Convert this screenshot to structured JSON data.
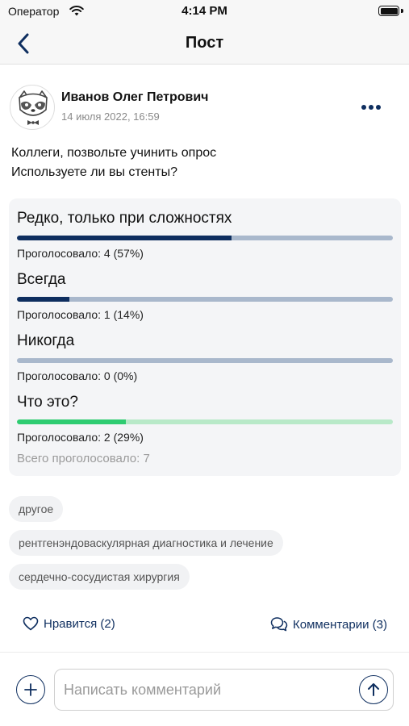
{
  "status_bar": {
    "carrier": "Оператор",
    "time": "4:14 PM"
  },
  "nav": {
    "title": "Пост"
  },
  "post": {
    "author": "Иванов Олег Петрович",
    "date": "14 июля 2022, 16:59",
    "text_line1": "Коллеги, позвольте учинить опрос",
    "text_line2": "Используете ли вы стенты?"
  },
  "poll": {
    "options": [
      {
        "label": "Редко, только при сложностях",
        "votes": "Проголосовало: 4 (57%)",
        "share": 0.57,
        "selected": false
      },
      {
        "label": "Всегда",
        "votes": "Проголосовало: 1 (14%)",
        "share": 0.14,
        "selected": false
      },
      {
        "label": "Никогда",
        "votes": "Проголосовало: 0 (0%)",
        "share": 0,
        "selected": false
      },
      {
        "label": "Что это?",
        "votes": "Проголосовало: 2 (29%)",
        "share": 0.29,
        "selected": true
      }
    ],
    "total": "Всего проголосовало: 7"
  },
  "tags": [
    "другое",
    "рентгенэндоваскулярная диагностика и лечение",
    "сердечно-сосудистая хирургия"
  ],
  "actions": {
    "like_label": "Нравится (2)",
    "comments_label": "Комментарии (3)"
  },
  "composer": {
    "placeholder": "Написать комментарий"
  },
  "icons": {
    "back": "chevron-left-icon",
    "more": "ellipsis-icon",
    "like": "heart-icon",
    "comments": "chat-bubbles-icon",
    "add": "plus-icon",
    "send": "arrow-up-icon"
  },
  "colors": {
    "accent": "#0e2e5f",
    "bar_track": "#a9b8cc",
    "selected_fill": "#2ecc71",
    "selected_track": "#b8e9c8"
  }
}
